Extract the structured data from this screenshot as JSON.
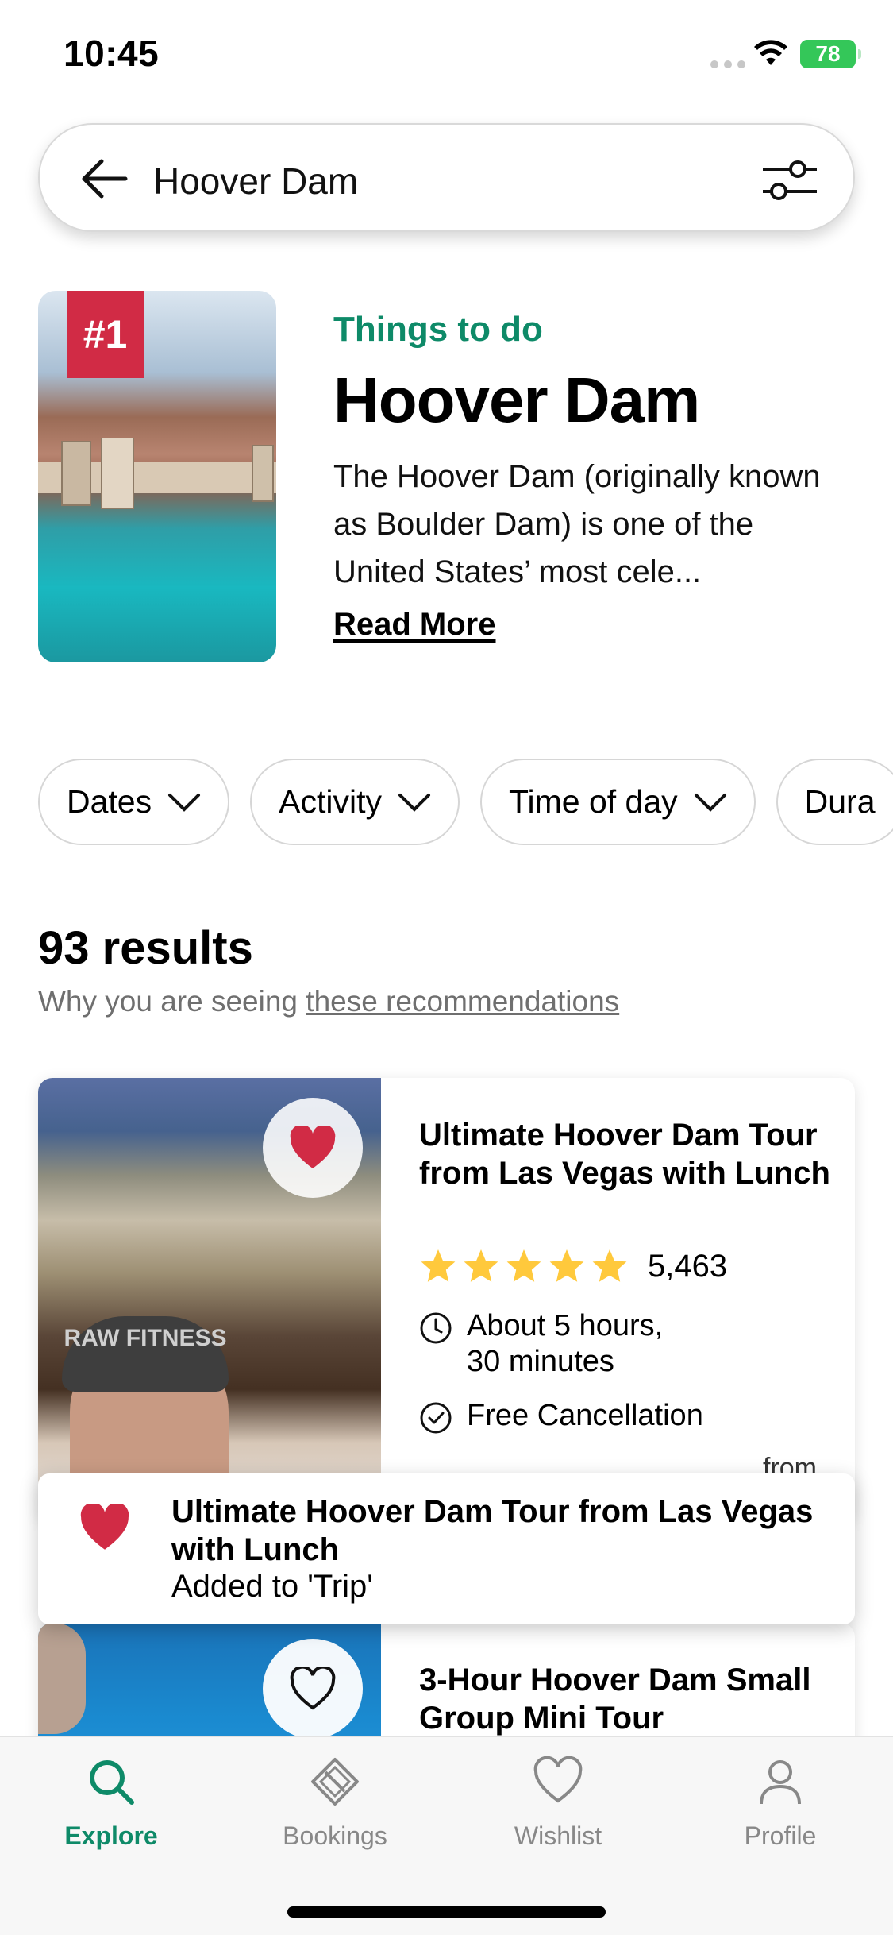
{
  "status_bar": {
    "time": "10:45",
    "battery": "78"
  },
  "search": {
    "query": "Hoover Dam"
  },
  "hero": {
    "rank": "#1",
    "category": "Things to do",
    "title": "Hoover Dam",
    "description": "The Hoover Dam (originally known as Boulder Dam) is one of the United States’ most cele...",
    "read_more": "Read More"
  },
  "filters": [
    "Dates",
    "Activity",
    "Time of day",
    "Dura"
  ],
  "results": {
    "count": "93 results",
    "why_prefix": "Why you are seeing ",
    "why_link": "these recommendations"
  },
  "cards": [
    {
      "title": "Ultimate Hoover Dam Tour from Las Vegas with Lunch",
      "rating_stars": 5,
      "review_count": "5,463",
      "duration": "About 5 hours, 30 minutes",
      "cancellation": "Free Cancellation",
      "price_prefix": "from",
      "favorited": true,
      "image_caption": "RAW FITNESS"
    },
    {
      "title": "3-Hour Hoover Dam Small Group Mini Tour",
      "favorited": false
    }
  ],
  "toast": {
    "title": "Ultimate Hoover Dam Tour from Las Vegas with Lunch",
    "subtitle": "Added to 'Trip'"
  },
  "tabs": [
    {
      "label": "Explore",
      "icon": "search-icon",
      "active": true
    },
    {
      "label": "Bookings",
      "icon": "ticket-icon",
      "active": false
    },
    {
      "label": "Wishlist",
      "icon": "heart-icon",
      "active": false
    },
    {
      "label": "Profile",
      "icon": "person-icon",
      "active": false
    }
  ],
  "colors": {
    "accent_green": "#0e8a68",
    "heart_red": "#d12b45",
    "star_yellow": "#ffc93c",
    "battery_green": "#34c759"
  }
}
